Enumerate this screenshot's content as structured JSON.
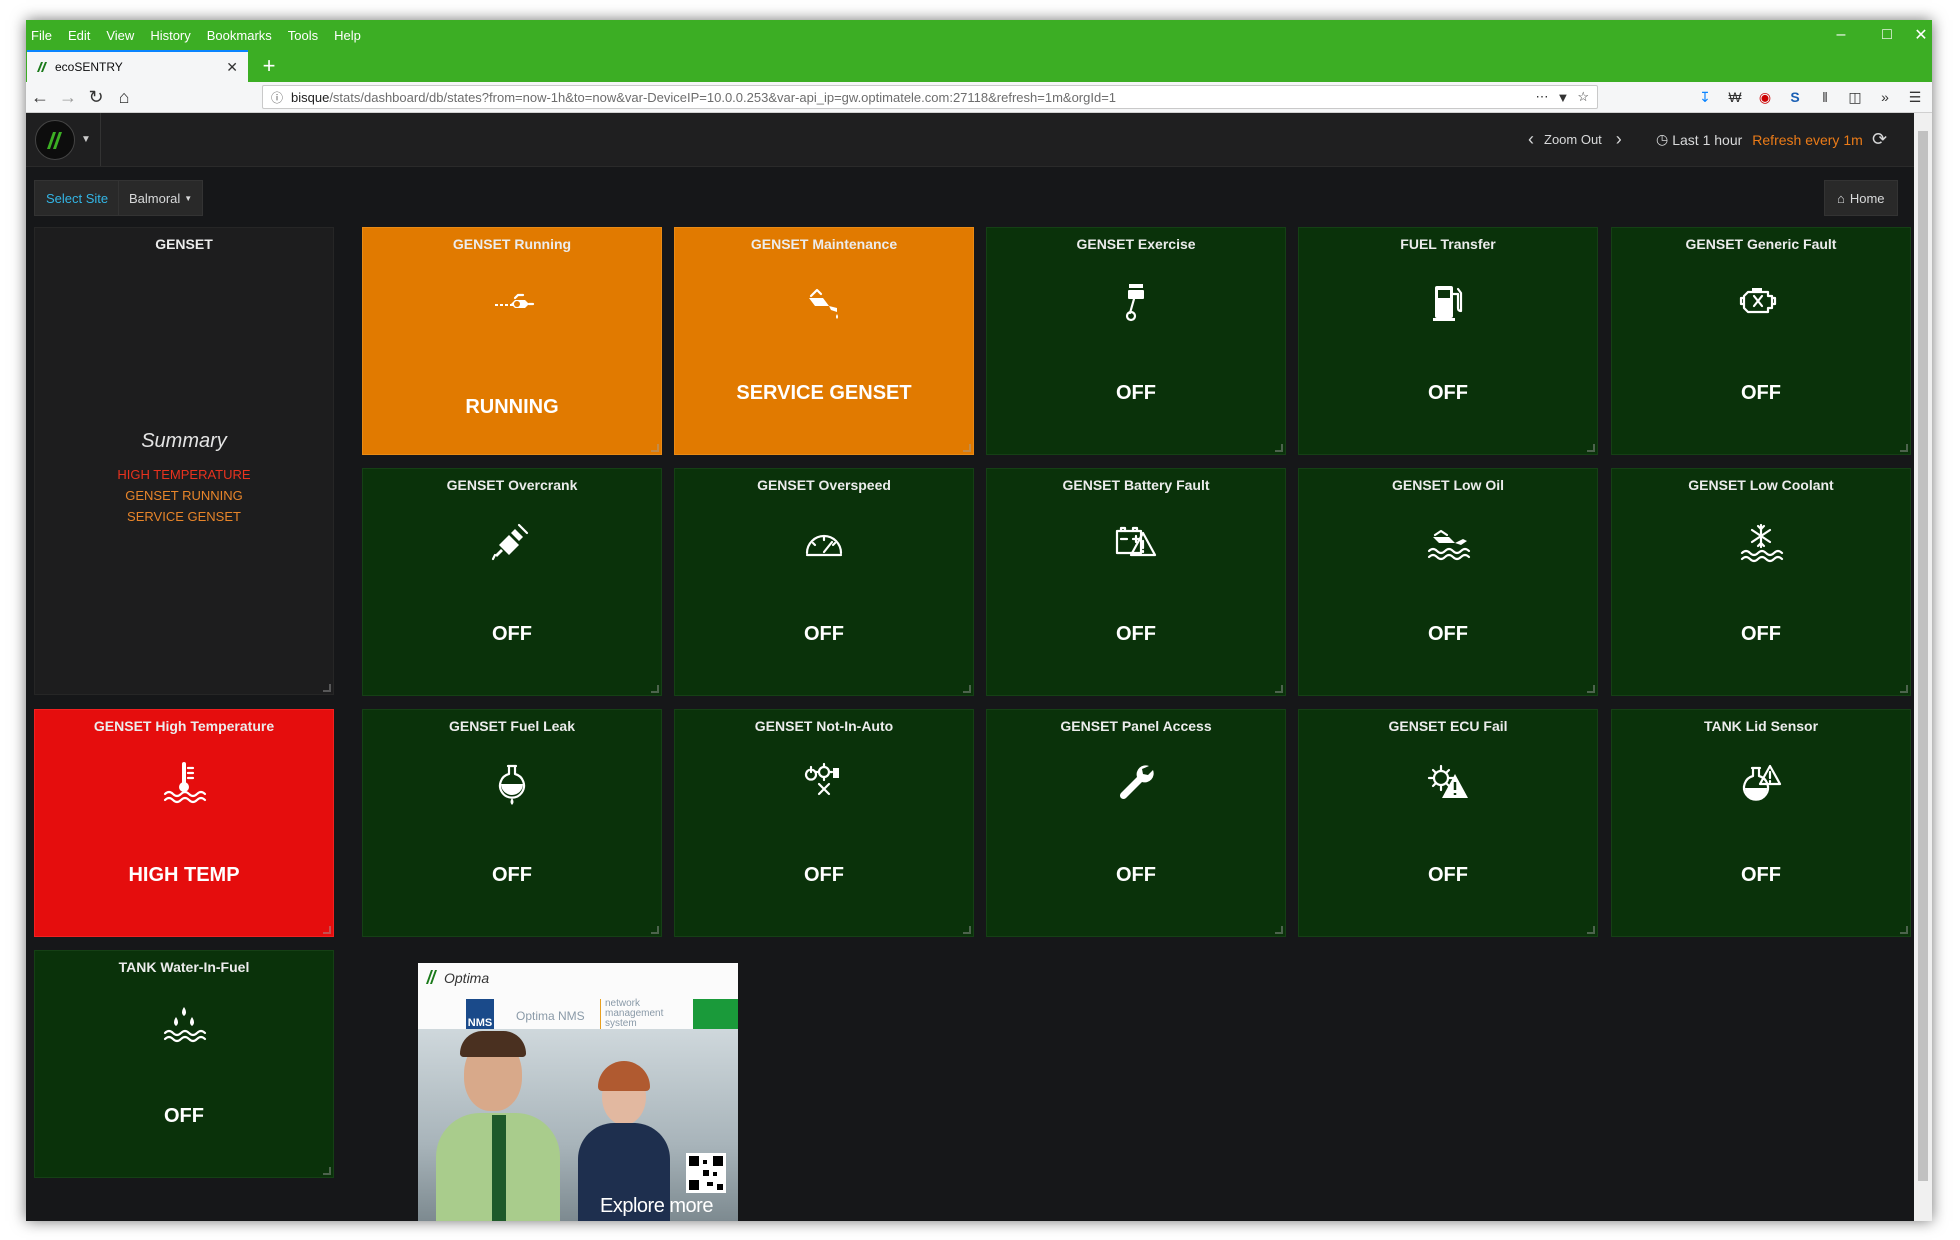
{
  "browser": {
    "menu": [
      "File",
      "Edit",
      "View",
      "History",
      "Bookmarks",
      "Tools",
      "Help"
    ],
    "tab_title": "ecoSENTRY",
    "url_host": "bisque",
    "url_path": "/stats/dashboard/db/states?from=now-1h&to=now&var-DeviceIP=10.0.0.253&var-api_ip=gw.optimatele.com:27118&refresh=1m&orgId=1",
    "chrome_color": "#3cae24"
  },
  "topnav": {
    "zoom_out": "Zoom Out",
    "time_range": "Last 1 hour",
    "refresh": "Refresh every 1m"
  },
  "vars": {
    "label": "Select Site",
    "value": "Balmoral",
    "home": "Home"
  },
  "colors": {
    "off": "#0a320a",
    "warn": "#e17a00",
    "alarm": "#e50d0d",
    "summary_red": "#e8321e",
    "summary_orange": "#e8852a"
  },
  "summary": {
    "title": "GENSET",
    "heading": "Summary",
    "lines": [
      "HIGH TEMPERATURE",
      "GENSET RUNNING",
      "SERVICE GENSET"
    ]
  },
  "panels": [
    {
      "title": "GENSET Running",
      "value": "RUNNING",
      "state": "warn",
      "icon": "generator-icon"
    },
    {
      "title": "GENSET Maintenance",
      "value": "SERVICE GENSET",
      "state": "warn",
      "icon": "oil-can-icon"
    },
    {
      "title": "GENSET Exercise",
      "value": "OFF",
      "state": "off",
      "icon": "piston-icon"
    },
    {
      "title": "FUEL Transfer",
      "value": "OFF",
      "state": "off",
      "icon": "fuel-pump-icon"
    },
    {
      "title": "GENSET Generic Fault",
      "value": "OFF",
      "state": "off",
      "icon": "engine-fault-icon"
    },
    {
      "title": "GENSET Overcrank",
      "value": "OFF",
      "state": "off",
      "icon": "spark-plug-icon"
    },
    {
      "title": "GENSET Overspeed",
      "value": "OFF",
      "state": "off",
      "icon": "speedometer-icon"
    },
    {
      "title": "GENSET Battery Fault",
      "value": "OFF",
      "state": "off",
      "icon": "battery-warning-icon"
    },
    {
      "title": "GENSET Low Oil",
      "value": "OFF",
      "state": "off",
      "icon": "oil-level-icon"
    },
    {
      "title": "GENSET Low Coolant",
      "value": "OFF",
      "state": "off",
      "icon": "coolant-icon"
    },
    {
      "title": "GENSET High Temperature",
      "value": "HIGH TEMP",
      "state": "alarm",
      "icon": "thermometer-icon"
    },
    {
      "title": "GENSET Fuel Leak",
      "value": "OFF",
      "state": "off",
      "icon": "flask-drop-icon"
    },
    {
      "title": "GENSET Not-In-Auto",
      "value": "OFF",
      "state": "off",
      "icon": "power-gear-hand-icon"
    },
    {
      "title": "GENSET Panel Access",
      "value": "OFF",
      "state": "off",
      "icon": "wrench-icon"
    },
    {
      "title": "GENSET ECU Fail",
      "value": "OFF",
      "state": "off",
      "icon": "gear-warning-icon"
    },
    {
      "title": "TANK Lid Sensor",
      "value": "OFF",
      "state": "off",
      "icon": "flask-warning-icon"
    },
    {
      "title": "TANK Water-In-Fuel",
      "value": "OFF",
      "state": "off",
      "icon": "water-drops-icon"
    }
  ],
  "ad": {
    "brand": "Optima",
    "product": "Optima NMS",
    "tagline": "network management system",
    "cta": "Explore more"
  }
}
